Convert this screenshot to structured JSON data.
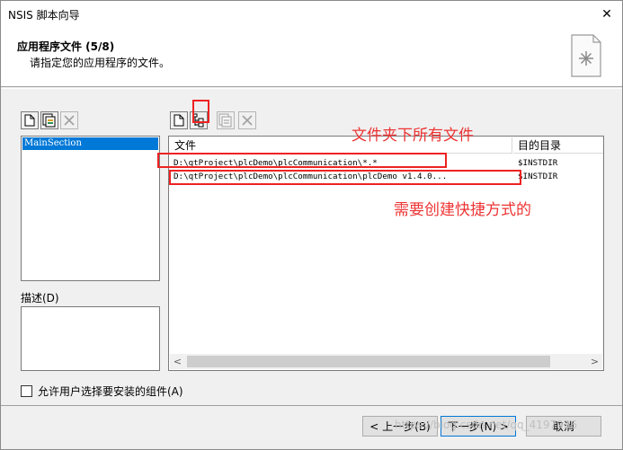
{
  "window": {
    "title": "NSIS 脚本向导",
    "close_glyph": "✕"
  },
  "header": {
    "title": "应用程序文件 (5/8)",
    "subtitle": "请指定您的应用程序的文件。",
    "icon": "document-star-icon"
  },
  "sections_panel": {
    "items": [
      {
        "label": "MainSection",
        "selected": true
      }
    ]
  },
  "description": {
    "label": "描述(D)"
  },
  "file_list": {
    "columns": [
      "文件",
      "目的目录"
    ],
    "rows": [
      {
        "file": "D:\\qtProject\\plcDemo\\plcCommunication\\*.*",
        "dest": "$INSTDIR"
      },
      {
        "file": "D:\\qtProject\\plcDemo\\plcCommunication\\plcDemo v1.4.0...",
        "dest": "$INSTDIR"
      }
    ],
    "scroll_left": "<",
    "scroll_right": ">"
  },
  "checkbox": {
    "label": "允许用户选择要安装的组件(A)",
    "checked": false
  },
  "buttons": {
    "back": "< 上一步(B)",
    "next": "下一步(N) >",
    "cancel": "取消"
  },
  "annotations": {
    "folder_note": "文件夹下所有文件",
    "shortcut_note": "需要创建快捷方式的"
  },
  "watermark": "https://blog.csdn.net/qq_4197936",
  "colors": {
    "selection": "#0078d7",
    "annotation": "#ee2222"
  }
}
